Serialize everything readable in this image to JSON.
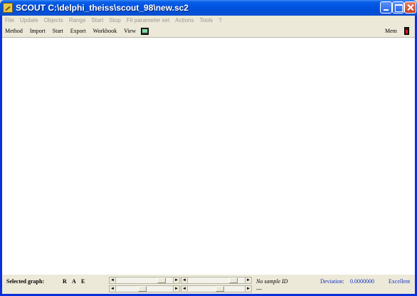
{
  "window": {
    "title": "SCOUT C:\\delphi_theiss\\scout_98\\new.sc2"
  },
  "menubar": {
    "items": [
      {
        "label": "File"
      },
      {
        "label": "Update"
      },
      {
        "label": "Objects"
      },
      {
        "label": "Range"
      },
      {
        "label": "Start"
      },
      {
        "label": "Stop"
      },
      {
        "label": "Fit parameter set"
      },
      {
        "label": "Actions"
      },
      {
        "label": "Tools"
      },
      {
        "label": "?"
      }
    ]
  },
  "toolbar": {
    "items": [
      {
        "label": "Method"
      },
      {
        "label": "Import"
      },
      {
        "label": "Start"
      },
      {
        "label": "Export"
      },
      {
        "label": "Workbook"
      },
      {
        "label": "View"
      }
    ],
    "mem_label": "Mem"
  },
  "statusbar": {
    "selected_graph_label": "Selected graph:",
    "r": "R",
    "a": "A",
    "e": "E",
    "sample_id": "No sample ID",
    "sample_dash": "---",
    "deviation_label": "Deviation:",
    "deviation_value": "0.0000000",
    "quality": "Excellent",
    "scrollbars": [
      {
        "position": 0.85
      },
      {
        "position": 0.85
      },
      {
        "position": 0.45
      },
      {
        "position": 0.58
      }
    ]
  },
  "colors": {
    "titlebar": "#0054e3",
    "status_text": "#1530c0",
    "disabled_menu": "#9c9a8e"
  }
}
